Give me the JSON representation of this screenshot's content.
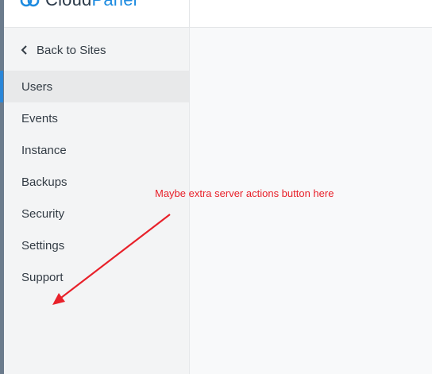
{
  "header": {
    "logo_word_1": "Cloud",
    "logo_word_2": "Panel",
    "brand_color": "#1d8be0"
  },
  "sidebar": {
    "back_label": "Back to Sites",
    "items": [
      {
        "label": "Users",
        "active": true
      },
      {
        "label": "Events",
        "active": false
      },
      {
        "label": "Instance",
        "active": false
      },
      {
        "label": "Backups",
        "active": false
      },
      {
        "label": "Security",
        "active": false
      },
      {
        "label": "Settings",
        "active": false
      },
      {
        "label": "Support",
        "active": false
      }
    ],
    "active_color": "#2a86d8"
  },
  "annotation": {
    "text": "Maybe extra server actions button here",
    "color": "#e8212a"
  }
}
